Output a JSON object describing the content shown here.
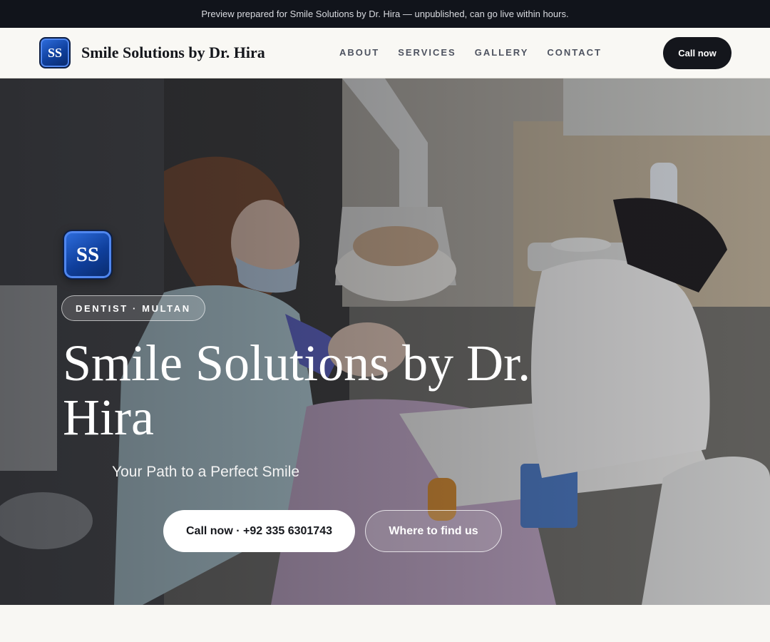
{
  "announcement": "Preview prepared for Smile Solutions by Dr. Hira — unpublished, can go live within hours.",
  "header": {
    "logo_initials": "SS",
    "brand": "Smile Solutions by Dr. Hira",
    "nav": [
      "ABOUT",
      "SERVICES",
      "GALLERY",
      "CONTACT"
    ],
    "call_label": "Call now"
  },
  "hero": {
    "logo_initials": "SS",
    "badge": "DENTIST · MULTAN",
    "title": "Smile Solutions by Dr. Hira",
    "tagline": "Your Path to a Perfect Smile",
    "primary_cta": "Call now · +92 335 6301743",
    "secondary_cta": "Where to find us"
  },
  "colors": {
    "topbar_bg": "#11141b",
    "nav_bg": "#f9f8f4",
    "dark_button": "#14161c",
    "logo_blue": "#0f3f9c"
  }
}
